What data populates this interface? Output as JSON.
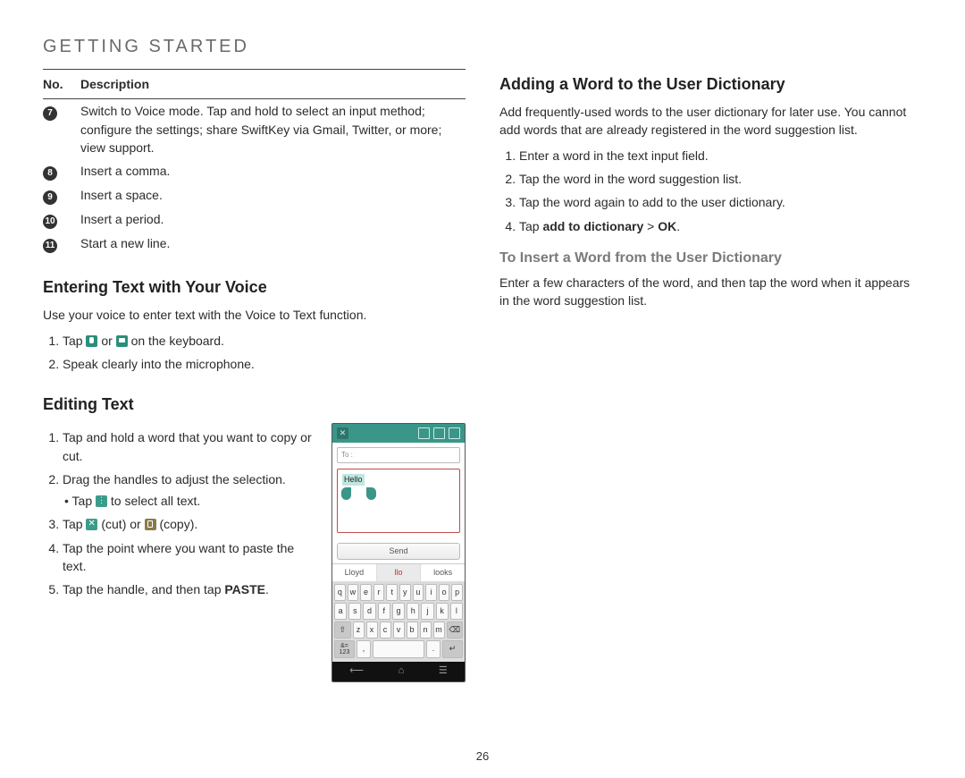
{
  "section_title": "GETTING STARTED",
  "page_number": "26",
  "table": {
    "head_no": "No.",
    "head_desc": "Description",
    "rows": [
      {
        "num": "7",
        "desc": "Switch to Voice mode. Tap and hold to select an input method; configure the settings; share SwiftKey via Gmail, Twitter, or more; view support."
      },
      {
        "num": "8",
        "desc": "Insert a comma."
      },
      {
        "num": "9",
        "desc": "Insert a space."
      },
      {
        "num": "10",
        "desc": "Insert a period."
      },
      {
        "num": "11",
        "desc": "Start a new line."
      }
    ]
  },
  "voice": {
    "heading": "Entering Text with Your Voice",
    "intro": "Use your voice to enter text with the Voice to Text function.",
    "step1_pre": "Tap ",
    "step1_mid": " or ",
    "step1_post": " on the keyboard.",
    "step2": "Speak clearly into the microphone."
  },
  "editing": {
    "heading": "Editing Text",
    "step1": "Tap and hold a word that you want to copy or cut.",
    "step2": "Drag the handles to adjust the selection.",
    "step2a_pre": "Tap ",
    "step2a_post": " to select all text.",
    "step3_pre": "Tap ",
    "step3_cut": " (cut) or ",
    "step3_post": " (copy).",
    "step4": "Tap the point where you want to paste the text.",
    "step5_pre": "Tap the handle, and then tap ",
    "step5_bold": "PASTE",
    "step5_post": "."
  },
  "phone": {
    "to_label": "To :",
    "sel_text": "Hello",
    "send": "Send",
    "sugg": [
      "Lloyd",
      "llo",
      "looks"
    ],
    "row1": [
      "q",
      "w",
      "e",
      "r",
      "t",
      "y",
      "u",
      "i",
      "o",
      "p"
    ],
    "row2": [
      "a",
      "s",
      "d",
      "f",
      "g",
      "h",
      "j",
      "k",
      "l"
    ],
    "row3_shift": "⇧",
    "row3": [
      "z",
      "x",
      "c",
      "v",
      "b",
      "n",
      "m"
    ],
    "row3_del": "⌫",
    "row4_123": "&=\n123",
    "row4_comma": ",",
    "row4_space": " ",
    "row4_period": ".",
    "row4_enter": "↵",
    "nav_back": "⟵",
    "nav_home": "⌂",
    "nav_recent": "☰"
  },
  "dict": {
    "heading": "Adding a Word to the User Dictionary",
    "intro": "Add frequently-used words to the user dictionary for later use. You cannot add words that are already registered in the word suggestion list.",
    "s1": "Enter a word in the text input field.",
    "s2": "Tap the word in the word suggestion list.",
    "s3": "Tap the word again to add to the user dictionary.",
    "s4_pre": "Tap ",
    "s4_bold": "add to dictionary",
    "s4_gt": " > ",
    "s4_bold2": "OK",
    "s4_post": ".",
    "sub_heading": "To Insert a Word from the User Dictionary",
    "sub_body": "Enter a few characters of the word, and then tap the word when it appears in the word suggestion list."
  }
}
